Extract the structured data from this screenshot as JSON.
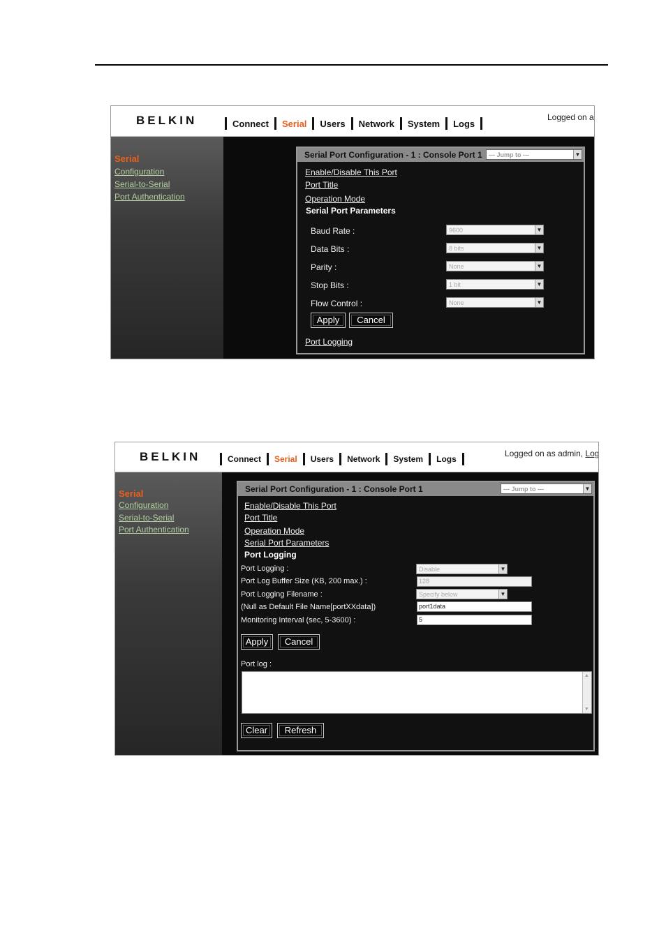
{
  "screens": [
    {
      "header": {
        "logo": "BELKIN",
        "nav": [
          "Connect",
          "Serial",
          "Users",
          "Network",
          "System",
          "Logs"
        ],
        "active_nav": "Serial",
        "logged_text": "Logged on a",
        "logged_link": ""
      },
      "sidebar": {
        "section": "Serial",
        "links": [
          "Configuration",
          "Serial-to-Serial",
          "Port Authentication"
        ]
      },
      "panel": {
        "title": "Serial Port Configuration - 1 : Console Port 1",
        "jump_placeholder": "--- Jump to ---",
        "links": [
          "Enable/Disable This Port",
          "Port Title",
          "Operation Mode"
        ],
        "current": "Serial Port Parameters",
        "fields": [
          {
            "label": "Baud Rate :",
            "value": "9600"
          },
          {
            "label": "Data Bits :",
            "value": "8 bits"
          },
          {
            "label": "Parity :",
            "value": "None"
          },
          {
            "label": "Stop Bits :",
            "value": "1 bit"
          },
          {
            "label": "Flow Control :",
            "value": "None"
          }
        ],
        "apply": "Apply",
        "cancel": "Cancel",
        "footer_link": "Port Logging"
      }
    },
    {
      "header": {
        "logo": "BELKIN",
        "nav": [
          "Connect",
          "Serial",
          "Users",
          "Network",
          "System",
          "Logs"
        ],
        "active_nav": "Serial",
        "logged_text": "Logged on as admin, ",
        "logged_link": "Logo"
      },
      "sidebar": {
        "section": "Serial",
        "links": [
          "Configuration",
          "Serial-to-Serial",
          "Port Authentication"
        ]
      },
      "panel": {
        "title": "Serial Port Configuration - 1 : Console Port 1",
        "jump_placeholder": "--- Jump to ---",
        "links": [
          "Enable/Disable This Port",
          "Port Title",
          "Operation Mode",
          "Serial Port Parameters"
        ],
        "current": "Port Logging",
        "fields": [
          {
            "label": "Port Logging :",
            "value": "Disable",
            "kind": "select"
          },
          {
            "label": "Port Log Buffer Size (KB, 200 max.) :",
            "value": "128",
            "kind": "input-disabled"
          },
          {
            "label": "Port Logging Filename :",
            "value": "Specify below",
            "kind": "select"
          },
          {
            "label": "(Null as Default File Name[portXXdata])",
            "value": "port1data",
            "kind": "input"
          },
          {
            "label": "Monitoring Interval (sec, 5-3600) :",
            "value": "5",
            "kind": "input"
          }
        ],
        "apply": "Apply",
        "cancel": "Cancel",
        "port_log_label": "Port log :",
        "clear": "Clear",
        "refresh": "Refresh"
      }
    }
  ]
}
